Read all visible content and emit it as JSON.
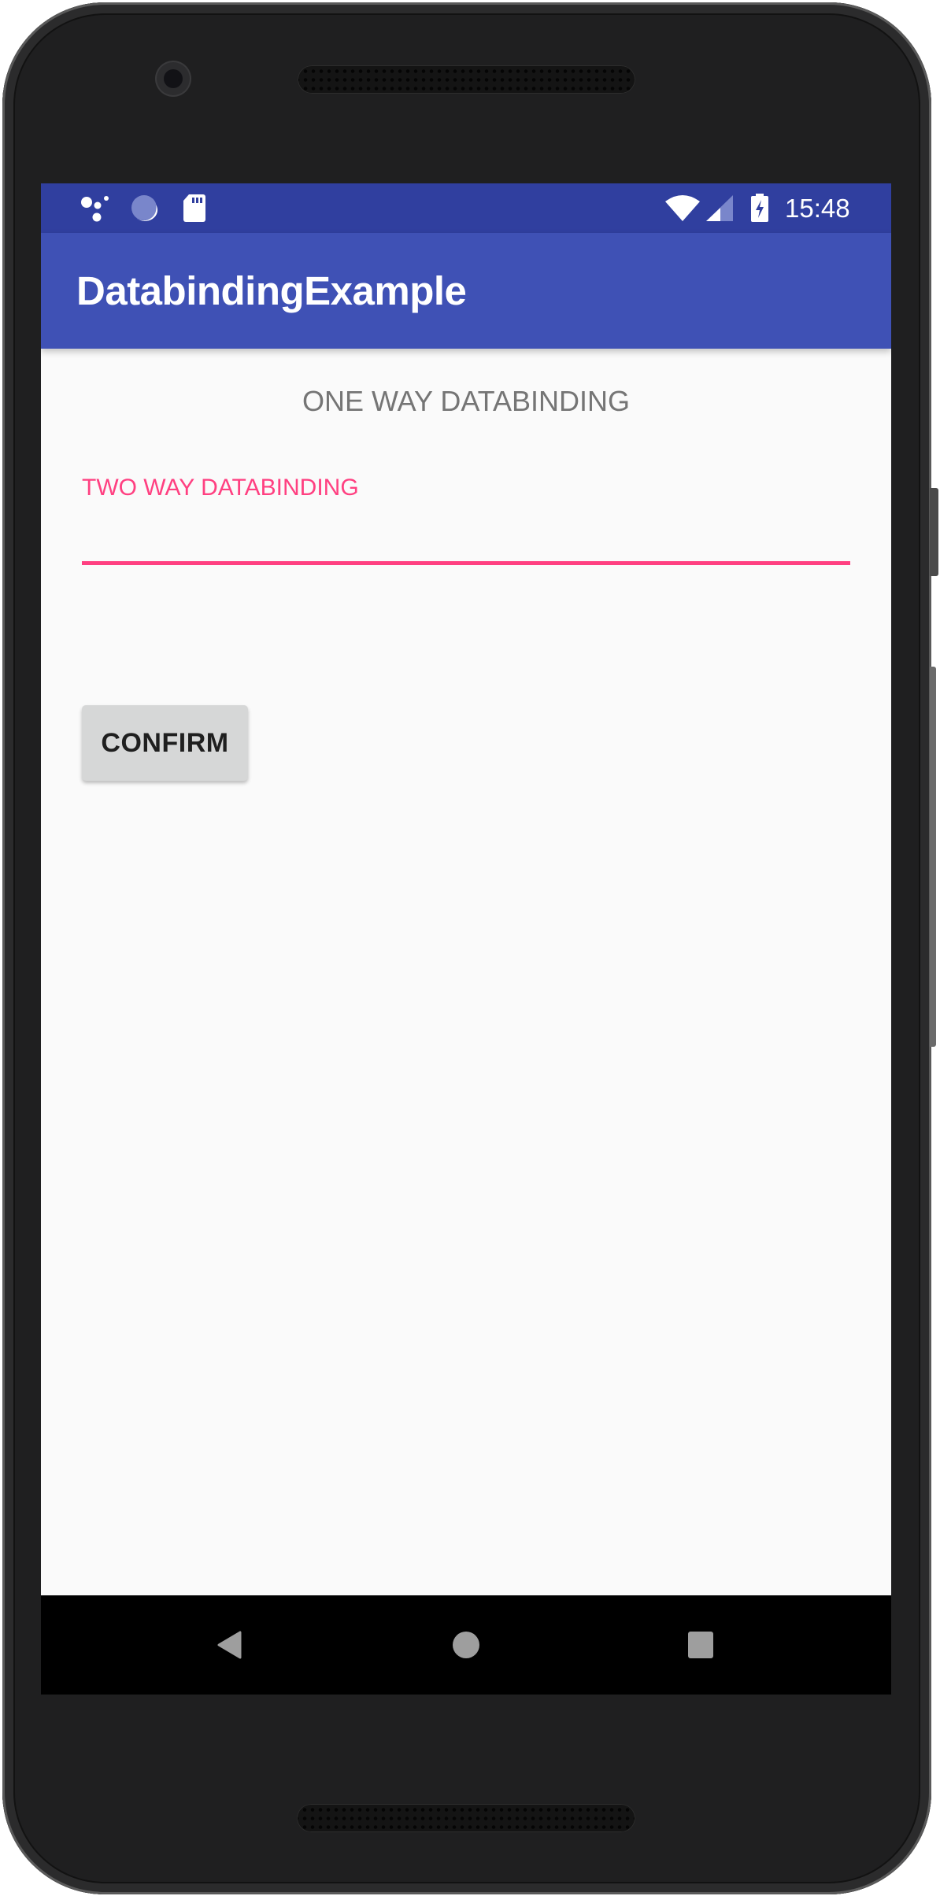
{
  "device": {
    "frame": "android-phone"
  },
  "status_bar": {
    "icons_left": [
      "assistant-dots-icon",
      "sync-progress-icon",
      "sd-card-icon"
    ],
    "icons_right": [
      "wifi-icon",
      "cell-signal-icon",
      "battery-charging-icon"
    ],
    "time": "15:48"
  },
  "toolbar": {
    "title": "DatabindingExample"
  },
  "content": {
    "one_way_text": "ONE WAY DATABINDING",
    "two_way_field": {
      "label": "TWO WAY DATABINDING",
      "value": "",
      "placeholder": ""
    },
    "confirm_button": "CONFIRM"
  },
  "nav_bar": {
    "buttons": [
      "back",
      "home",
      "recents"
    ]
  },
  "colors": {
    "status_bar": "#303F9F",
    "primary": "#3F51B5",
    "accent": "#FF4081",
    "background": "#FAFAFA",
    "secondary_text": "#757575",
    "button": "#D6D7D7",
    "nav_icon": "#9E9E9E"
  }
}
